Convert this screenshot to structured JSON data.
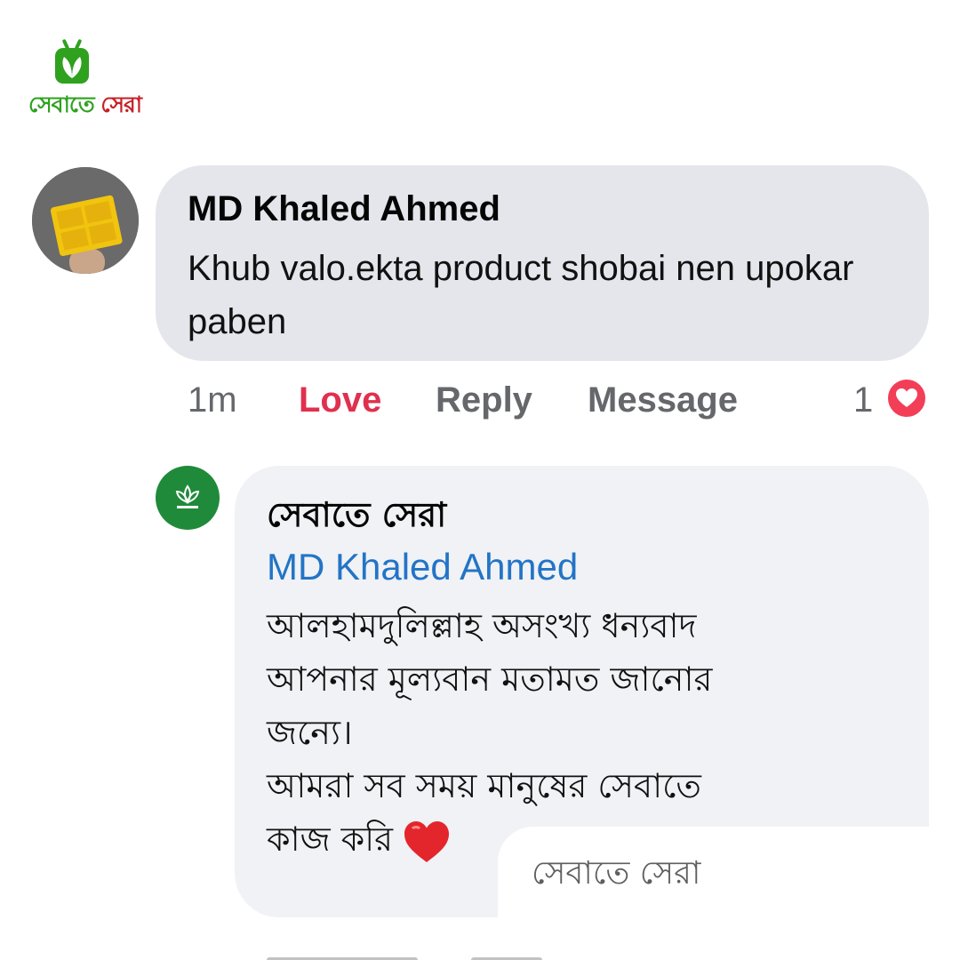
{
  "brand": {
    "logo_text_green": "সেবাতে",
    "logo_text_red": "সেরা"
  },
  "comment": {
    "author": "MD Khaled Ahmed",
    "text": "Khub valo.ekta product shobai nen upokar paben",
    "actions": {
      "time": "1m",
      "love": "Love",
      "reply": "Reply",
      "message": "Message"
    },
    "reaction_count": "1",
    "reaction_icon": "love-reaction-icon"
  },
  "reply": {
    "author": "সেবাতে সেরা",
    "mention": "MD Khaled Ahmed",
    "lines": [
      "আলহামদুলিল্লাহ অসংখ্য ধন্যবাদ",
      "আপনার মূল্যবান মতামত জানোর",
      "জন্যে।",
      "আমরা সব সময় মানুষের সেবাতে",
      "কাজ করি"
    ],
    "emoji": "heart-emoji",
    "faded_text": "সেবাতে সেরা"
  },
  "colors": {
    "love": "#e0304e",
    "mention": "#2374c6",
    "bubble_gray": "#e4e6eb",
    "reply_bubble": "#f0f2f5",
    "brand_green": "#2fa11f",
    "brand_red": "#c62026"
  }
}
